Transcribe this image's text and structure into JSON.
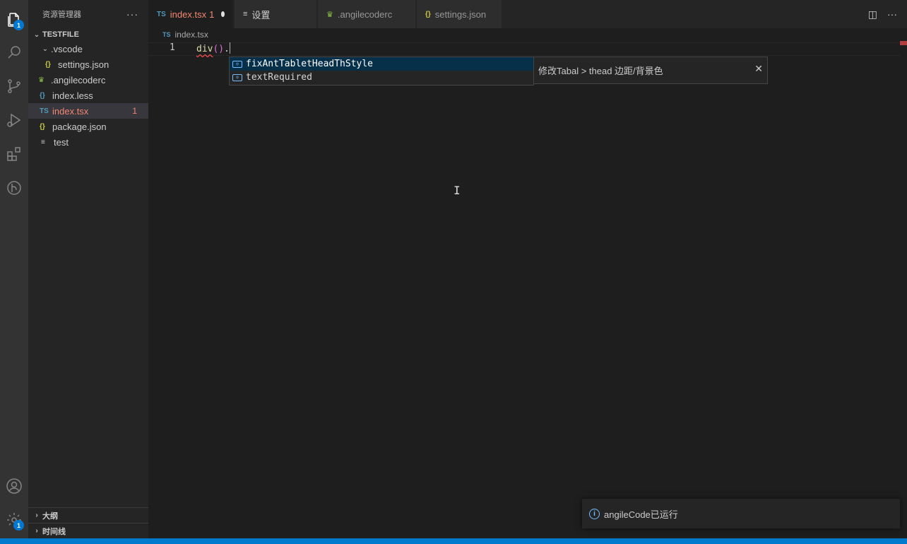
{
  "activity_bar": {
    "explorer_badge": "1",
    "settings_badge": "1"
  },
  "sidebar": {
    "title": "资源管理器",
    "more": "···",
    "section": "TESTFILE",
    "tree": [
      {
        "label": ".vscode",
        "icon": "",
        "indent": 1,
        "type": "folder"
      },
      {
        "label": "settings.json",
        "icon": "{}",
        "indent": 2,
        "type": "json"
      },
      {
        "label": ".angilecoderc",
        "icon": "ang",
        "indent": 1,
        "type": "ang"
      },
      {
        "label": "index.less",
        "icon": "{}",
        "indent": 1,
        "type": "less"
      },
      {
        "label": "index.tsx",
        "icon": "TS",
        "indent": 1,
        "type": "ts",
        "errors": "1"
      },
      {
        "label": "package.json",
        "icon": "{}",
        "indent": 1,
        "type": "json"
      },
      {
        "label": "test",
        "icon": "≡",
        "indent": 1,
        "type": "txt"
      }
    ],
    "outline": "大纲",
    "timeline": "时间线"
  },
  "tabs": [
    {
      "label": "index.tsx",
      "icon": "TS",
      "suffix": "1"
    },
    {
      "label": "设置",
      "icon": "≡"
    },
    {
      "label": ".angilecoderc",
      "icon": "ang"
    },
    {
      "label": "settings.json",
      "icon": "{}"
    }
  ],
  "breadcrumb": {
    "icon": "TS",
    "file": "index.tsx"
  },
  "editor": {
    "line_number": "1",
    "code_fn": "div",
    "code_parens": "()",
    "code_dot": "."
  },
  "suggest": {
    "items": [
      "fixAntTabletHeadThStyle",
      "textRequired"
    ],
    "detail": "修改Tabal > thead 边距/背景色",
    "close": "✕"
  },
  "notification": {
    "text": "angileCode已运行",
    "info_icon": "i"
  },
  "colors": {
    "accent": "#007acc",
    "error": "#f48771",
    "ts_icon": "#519aba",
    "json_icon": "#cbcb41"
  }
}
